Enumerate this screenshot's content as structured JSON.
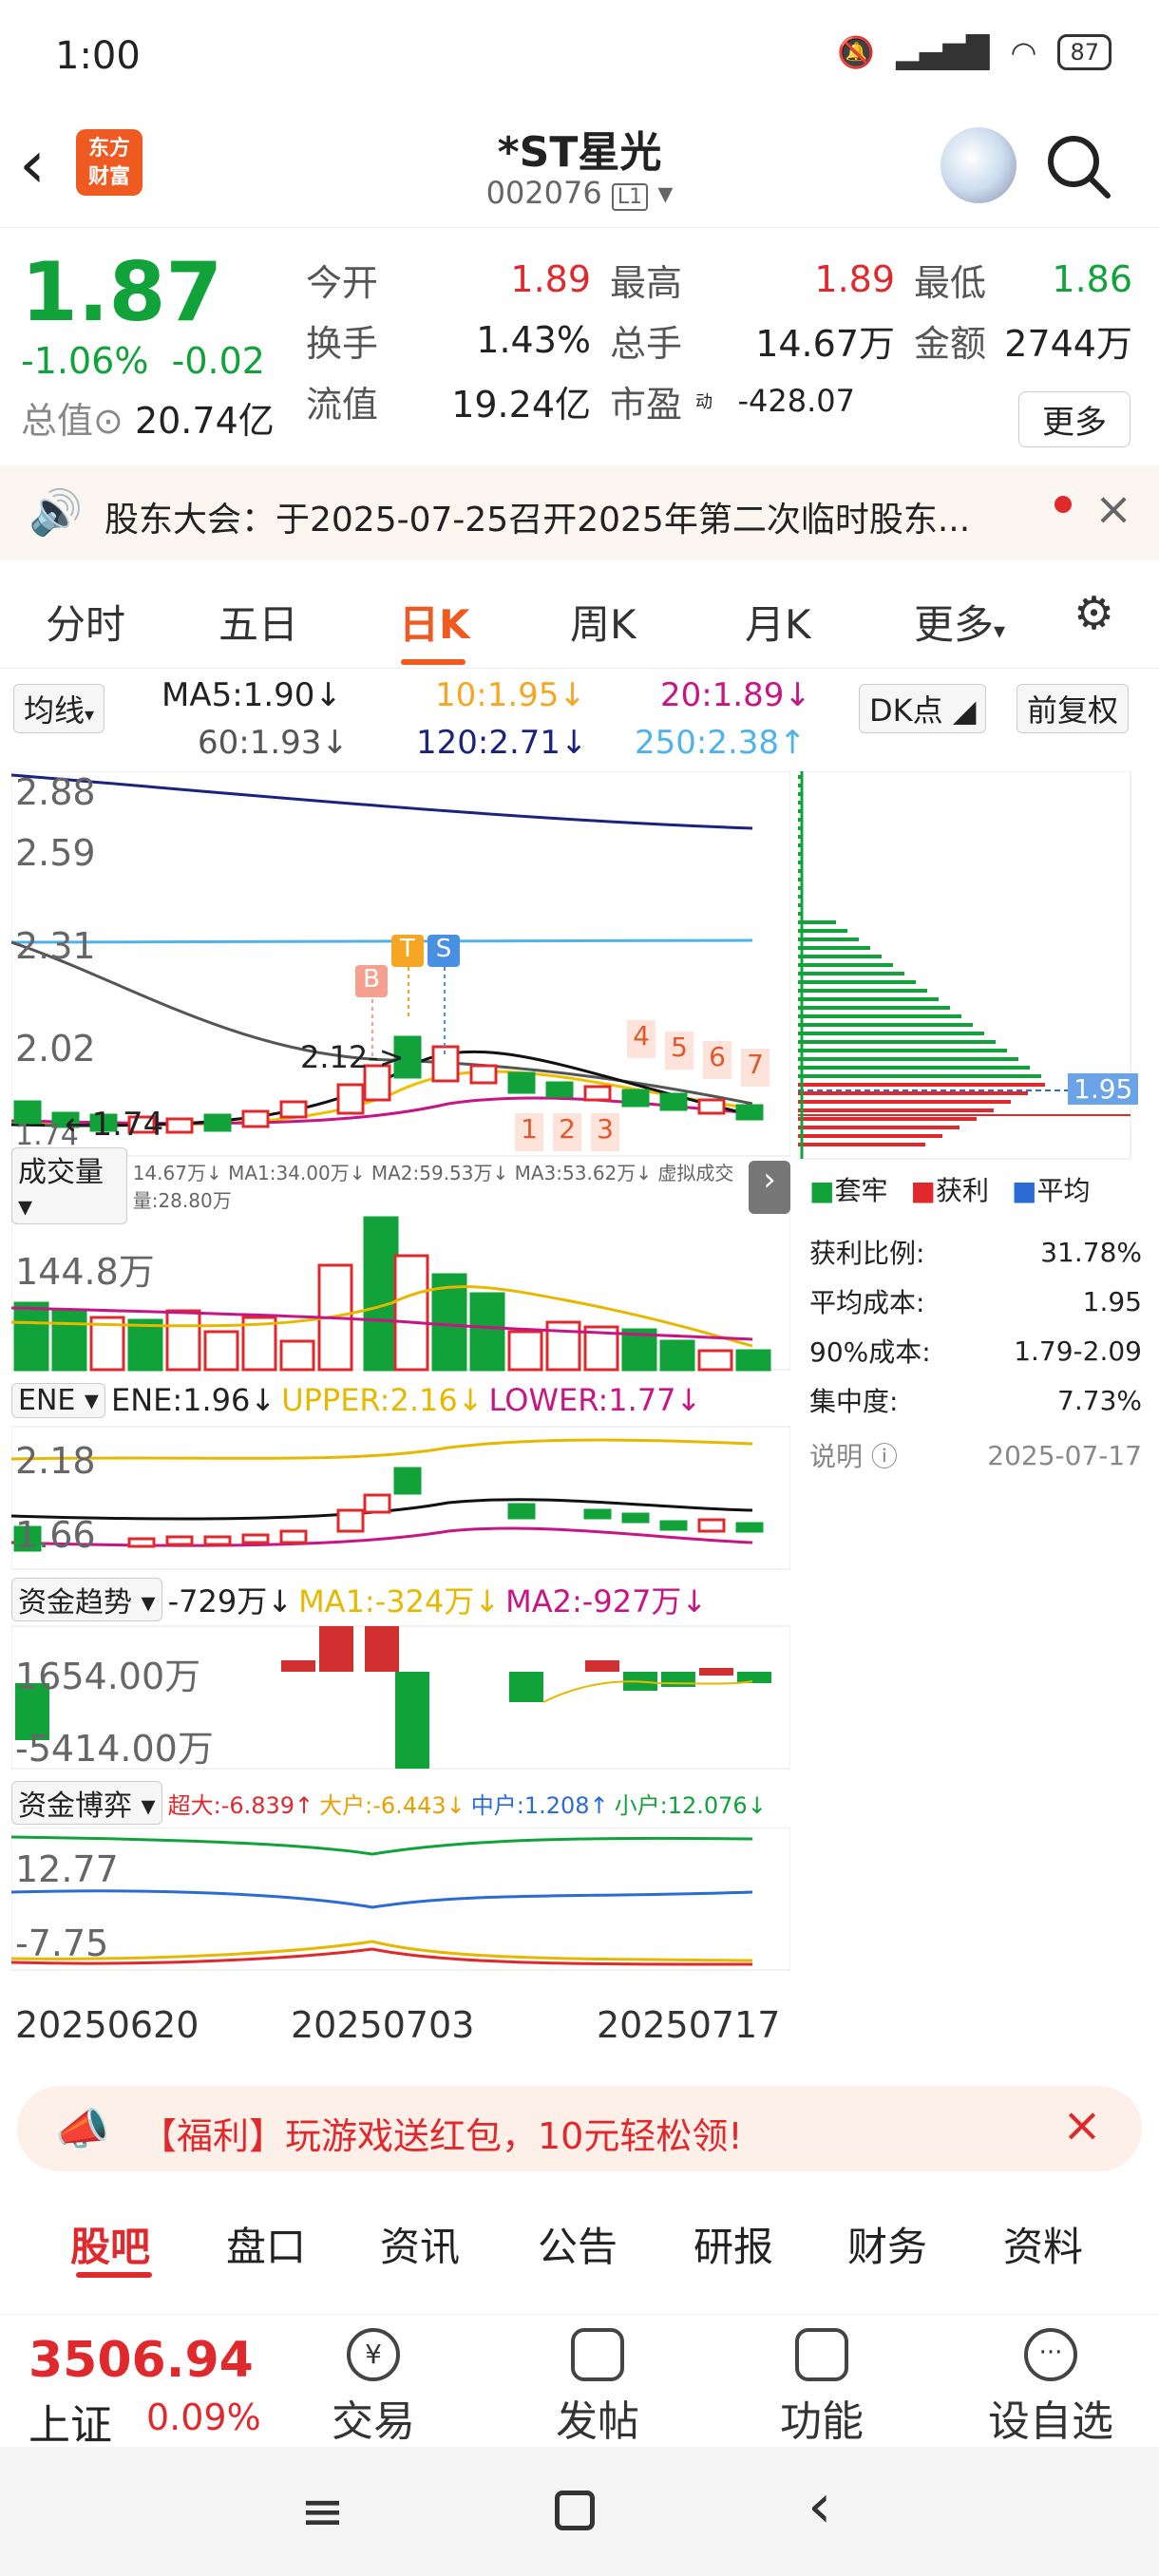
{
  "status": {
    "time": "1:00",
    "battery": "87"
  },
  "header": {
    "logo": "东方\n财富",
    "title": "*ST星光",
    "code": "002076",
    "level": "L1"
  },
  "quote": {
    "price": "1.87",
    "change_pct": "-1.06%",
    "change": "-0.02",
    "cap_label": "总值",
    "cap_value": "20.74亿",
    "rows": [
      [
        {
          "l": "今开",
          "v": "1.89",
          "c": "red"
        },
        {
          "l": "最高",
          "v": "1.89",
          "c": "red"
        },
        {
          "l": "最低",
          "v": "1.86",
          "c": "green"
        }
      ],
      [
        {
          "l": "换手",
          "v": "1.43%",
          "c": ""
        },
        {
          "l": "总手",
          "v": "14.67万",
          "c": ""
        },
        {
          "l": "金额",
          "v": "2744万",
          "c": ""
        }
      ],
      [
        {
          "l": "流值",
          "v": "19.24亿",
          "c": ""
        },
        {
          "l": "市盈",
          "v": "-428.07",
          "c": ""
        }
      ]
    ],
    "pe_sup": "动",
    "more": "更多"
  },
  "notice": {
    "text": "股东大会：于2025-07-25召开2025年第二次临时股东..."
  },
  "tabs": [
    "分时",
    "五日",
    "日K",
    "周K",
    "月K",
    "更多"
  ],
  "ma": {
    "btn": "均线",
    "ma5": "MA5:1.90↓",
    "ma10": "10:1.95↓",
    "ma20": "20:1.89↓",
    "ma60": "60:1.93↓",
    "ma120": "120:2.71↓",
    "ma250": "250:2.38↑",
    "dk": "DK点",
    "adj": "前复权"
  },
  "chart": {
    "price_axis": [
      "2.88",
      "2.59",
      "2.31",
      "2.02",
      "1.74"
    ],
    "low_mark": "1.74",
    "annot": "2.12->",
    "markers": [
      "B",
      "T",
      "S"
    ],
    "counts": [
      "4",
      "5",
      "6",
      "7",
      "1",
      "2",
      "3"
    ],
    "vol_label": "成交量",
    "vol_text": "14.67万↓ MA1:34.00万↓ MA2:59.53万↓ MA3:53.62万↓ 虚拟成交量:28.80万",
    "vol_axis": "144.8万",
    "ene_label": "ENE",
    "ene_val": "ENE:1.96↓",
    "ene_up": "UPPER:2.16↓",
    "ene_low": "LOWER:1.77↓",
    "ene_axis": [
      "2.18",
      "1.66"
    ],
    "fund_label": "资金趋势",
    "fund_val": "-729万↓",
    "fund_ma1": "MA1:-324万↓",
    "fund_ma2": "MA2:-927万↓",
    "fund_axis": [
      "1654.00万",
      "-5414.00万"
    ],
    "game_label": "资金博弈",
    "game_super": "超大:-6.839↑",
    "game_big": "大户:-6.443↓",
    "game_mid": "中户:1.208↑",
    "game_small": "小户:12.076↓",
    "game_axis": [
      "12.77",
      "-7.75"
    ],
    "dates": [
      "20250620",
      "20250703",
      "20250717"
    ]
  },
  "side": {
    "price_tag": "1.95",
    "legend": [
      "套牢",
      "获利",
      "平均"
    ],
    "stats": [
      {
        "l": "获利比例:",
        "v": "31.78%"
      },
      {
        "l": "平均成本:",
        "v": "1.95"
      },
      {
        "l": "90%成本:",
        "v": "1.79-2.09"
      },
      {
        "l": "集中度:",
        "v": "7.73%"
      }
    ],
    "note": "说明",
    "date": "2025-07-17"
  },
  "ad": {
    "text": "【福利】玩游戏送红包，10元轻松领!"
  },
  "bottom_tabs": [
    "股吧",
    "盘口",
    "资讯",
    "公告",
    "研报",
    "财务",
    "资料"
  ],
  "footer": {
    "index_val": "3506.94",
    "index_name": "上证",
    "index_pct": "0.09%",
    "buttons": [
      "交易",
      "发帖",
      "功能",
      "设自选"
    ]
  },
  "colors": {
    "accent": "#ef5a20",
    "up": "#e0292c",
    "down": "#11a23a"
  }
}
